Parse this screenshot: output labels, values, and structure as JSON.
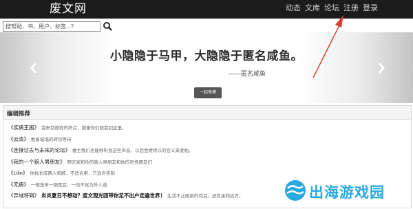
{
  "navbar": {
    "brand": "废文网",
    "links": [
      "动态",
      "文库",
      "论坛",
      "注册",
      "登录"
    ]
  },
  "search": {
    "placeholder": "搜帮助、书、用户、标签...?",
    "button_icon": "search-icon"
  },
  "carousel": {
    "title": "小隐隐于马甲，大隐隐于匿名咸鱼。",
    "subtitle": "——匿名咸鱼",
    "button_label": "一起来摸",
    "prev_icon": "chevron-left-icon",
    "next_icon": "chevron-right-icon"
  },
  "panel": {
    "title": "编辑推荐",
    "items": [
      {
        "name": "《疾病王国》",
        "desc": "我来到旅程的终点，谢谢你们陪我到这里。"
      },
      {
        "name": "《云清》",
        "desc": "数着城墙的砖块等待"
      },
      {
        "name": "《连接过去与未来的论坛》",
        "desc": "楼主我们也能够听到这些声音，以后会继续以的名义来发帖。"
      },
      {
        "name": "《我的一个狼人男朋友》",
        "desc": "预言家和他的狼人男朋友和他的奇怪朋友们"
      },
      {
        "name": "《Lilin》",
        "desc": "你找长成两人和解，不适合用，只适合告别"
      },
      {
        "name": "《无病》",
        "desc": "一根鱼竿一捆黑豆，一段不足为外人道"
      },
      {
        "name": "《异域特辑》",
        "desc": "炎炎夏日不想动？废文观光团带你足不出户走遍世界！",
        "extra": "生活不止眼前的苟且，还有坐和远方。"
      }
    ]
  },
  "watermark": {
    "text": "出海游戏园"
  },
  "colors": {
    "navbar_bg": "#1b1b1b",
    "annotation_arrow": "#d9412f",
    "watermark_blue": "#2aa8e0"
  }
}
